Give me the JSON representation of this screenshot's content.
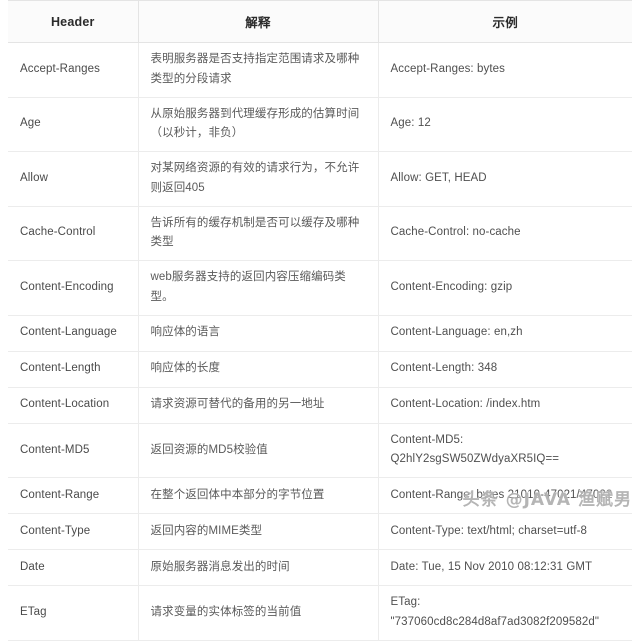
{
  "table": {
    "columns": [
      {
        "key": "header",
        "label": "Header"
      },
      {
        "key": "desc",
        "label": "解释"
      },
      {
        "key": "example",
        "label": "示例"
      }
    ],
    "rows": [
      {
        "header": "Accept-Ranges",
        "desc": "表明服务器是否支持指定范围请求及哪种类型的分段请求",
        "example": "Accept-Ranges: bytes",
        "tall": true
      },
      {
        "header": "Age",
        "desc": "从原始服务器到代理缓存形成的估算时间（以秒计，非负）",
        "example": "Age: 12",
        "tall": true
      },
      {
        "header": "Allow",
        "desc": "对某网络资源的有效的请求行为，不允许则返回405",
        "example": "Allow: GET, HEAD",
        "tall": true
      },
      {
        "header": "Cache-Control",
        "desc": "告诉所有的缓存机制是否可以缓存及哪种类型",
        "example": "Cache-Control: no-cache",
        "tall": false
      },
      {
        "header": "Content-Encoding",
        "desc": "web服务器支持的返回内容压缩编码类型。",
        "example": "Content-Encoding: gzip",
        "tall": false
      },
      {
        "header": "Content-Language",
        "desc": "响应体的语言",
        "example": "Content-Language: en,zh",
        "tall": false
      },
      {
        "header": "Content-Length",
        "desc": "响应体的长度",
        "example": "Content-Length: 348",
        "tall": false
      },
      {
        "header": "Content-Location",
        "desc": "请求资源可替代的备用的另一地址",
        "example": "Content-Location: /index.htm",
        "tall": false
      },
      {
        "header": "Content-MD5",
        "desc": "返回资源的MD5校验值",
        "example_line1": "Content-MD5:",
        "example_line2": "Q2hlY2sgSW50ZWdyaXR5IQ==",
        "tall": true
      },
      {
        "header": "Content-Range",
        "desc": "在整个返回体中本部分的字节位置",
        "example": "Content-Range: bytes 21010-47021/47022",
        "tall": false
      },
      {
        "header": "Content-Type",
        "desc": "返回内容的MIME类型",
        "example": "Content-Type: text/html; charset=utf-8",
        "tall": false
      },
      {
        "header": "Date",
        "desc": "原始服务器消息发出的时间",
        "example": "Date: Tue, 15 Nov 2010 08:12:31 GMT",
        "tall": false
      },
      {
        "header": "ETag",
        "desc": "请求变量的实体标签的当前值",
        "example_line1": "ETag:",
        "example_line2": "\"737060cd8c284d8af7ad3082f209582d\"",
        "tall": true
      }
    ]
  },
  "watermark": {
    "text": "头条 @JAVA 渔赋男"
  }
}
